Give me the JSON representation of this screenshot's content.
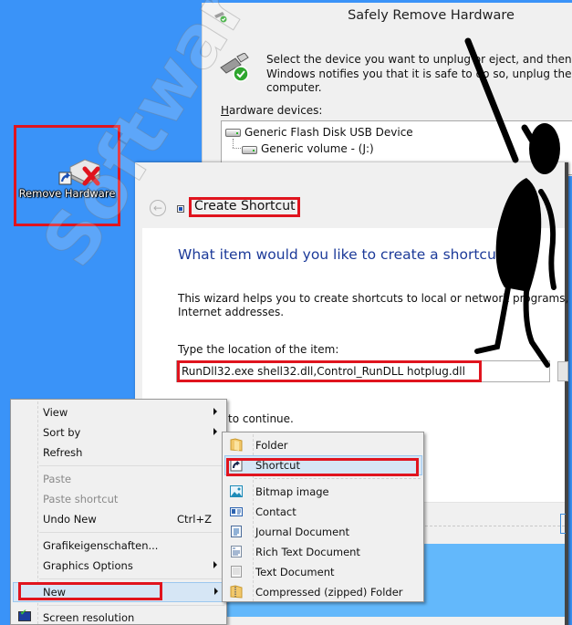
{
  "desktop": {
    "background_color": "#3a93f8",
    "highlight_color": "#e0141e",
    "icon": {
      "label": "Remove Hardware",
      "icon": "remove-hardware-shortcut-icon"
    }
  },
  "safely_remove_window": {
    "title": "Safely Remove Hardware",
    "description_lines": [
      "Select the device you want to unplug or eject, and then click St",
      "Windows notifies you that it is safe to do so, unplug the device",
      "computer."
    ],
    "devices_label_accel": "H",
    "devices_label_rest": "ardware devices:",
    "devices": [
      {
        "name": "Generic Flash Disk USB Device",
        "level": 0
      },
      {
        "name": "Generic volume - (J:)",
        "level": 1
      }
    ]
  },
  "create_shortcut_window": {
    "back_icon": "back-arrow-icon",
    "title": "Create Shortcut",
    "question": "What item would you like to create a shortcut for?",
    "help_lines": [
      "This wizard helps you to create shortcuts to local or network programs, files, fold",
      "Internet addresses."
    ],
    "location_label": "Type the location of the item:",
    "location_value": "RunDll32.exe shell32.dll,Control_RunDLL hotplug.dll",
    "continue_text": "to continue."
  },
  "context_menu": {
    "items": [
      {
        "label": "View",
        "submenu": true,
        "disabled": false
      },
      {
        "label": "Sort by",
        "submenu": true,
        "disabled": false
      },
      {
        "label": "Refresh",
        "submenu": false,
        "disabled": false
      },
      {
        "label": "Paste",
        "submenu": false,
        "disabled": true
      },
      {
        "label": "Paste shortcut",
        "submenu": false,
        "disabled": true
      },
      {
        "label": "Undo New",
        "shortcut": "Ctrl+Z",
        "submenu": false,
        "disabled": false
      },
      {
        "label": "Grafikeigenschaften...",
        "submenu": false,
        "disabled": false
      },
      {
        "label": "Graphics Options",
        "submenu": true,
        "disabled": false
      },
      {
        "label": "New",
        "submenu": true,
        "disabled": false,
        "selected": true
      },
      {
        "label": "Screen resolution",
        "submenu": false,
        "disabled": false
      }
    ]
  },
  "new_submenu": {
    "items": [
      {
        "label": "Folder",
        "icon": "folder-icon"
      },
      {
        "label": "Shortcut",
        "icon": "shortcut-icon",
        "selected": true
      },
      {
        "label": "Bitmap image",
        "icon": "bitmap-image-icon"
      },
      {
        "label": "Contact",
        "icon": "contact-icon"
      },
      {
        "label": "Journal Document",
        "icon": "journal-document-icon"
      },
      {
        "label": "Rich Text Document",
        "icon": "rich-text-document-icon"
      },
      {
        "label": "Text Document",
        "icon": "text-document-icon"
      },
      {
        "label": "Compressed (zipped) Folder",
        "icon": "zipped-folder-icon"
      }
    ]
  },
  "watermark": {
    "text": "SoftwareOK.com"
  }
}
